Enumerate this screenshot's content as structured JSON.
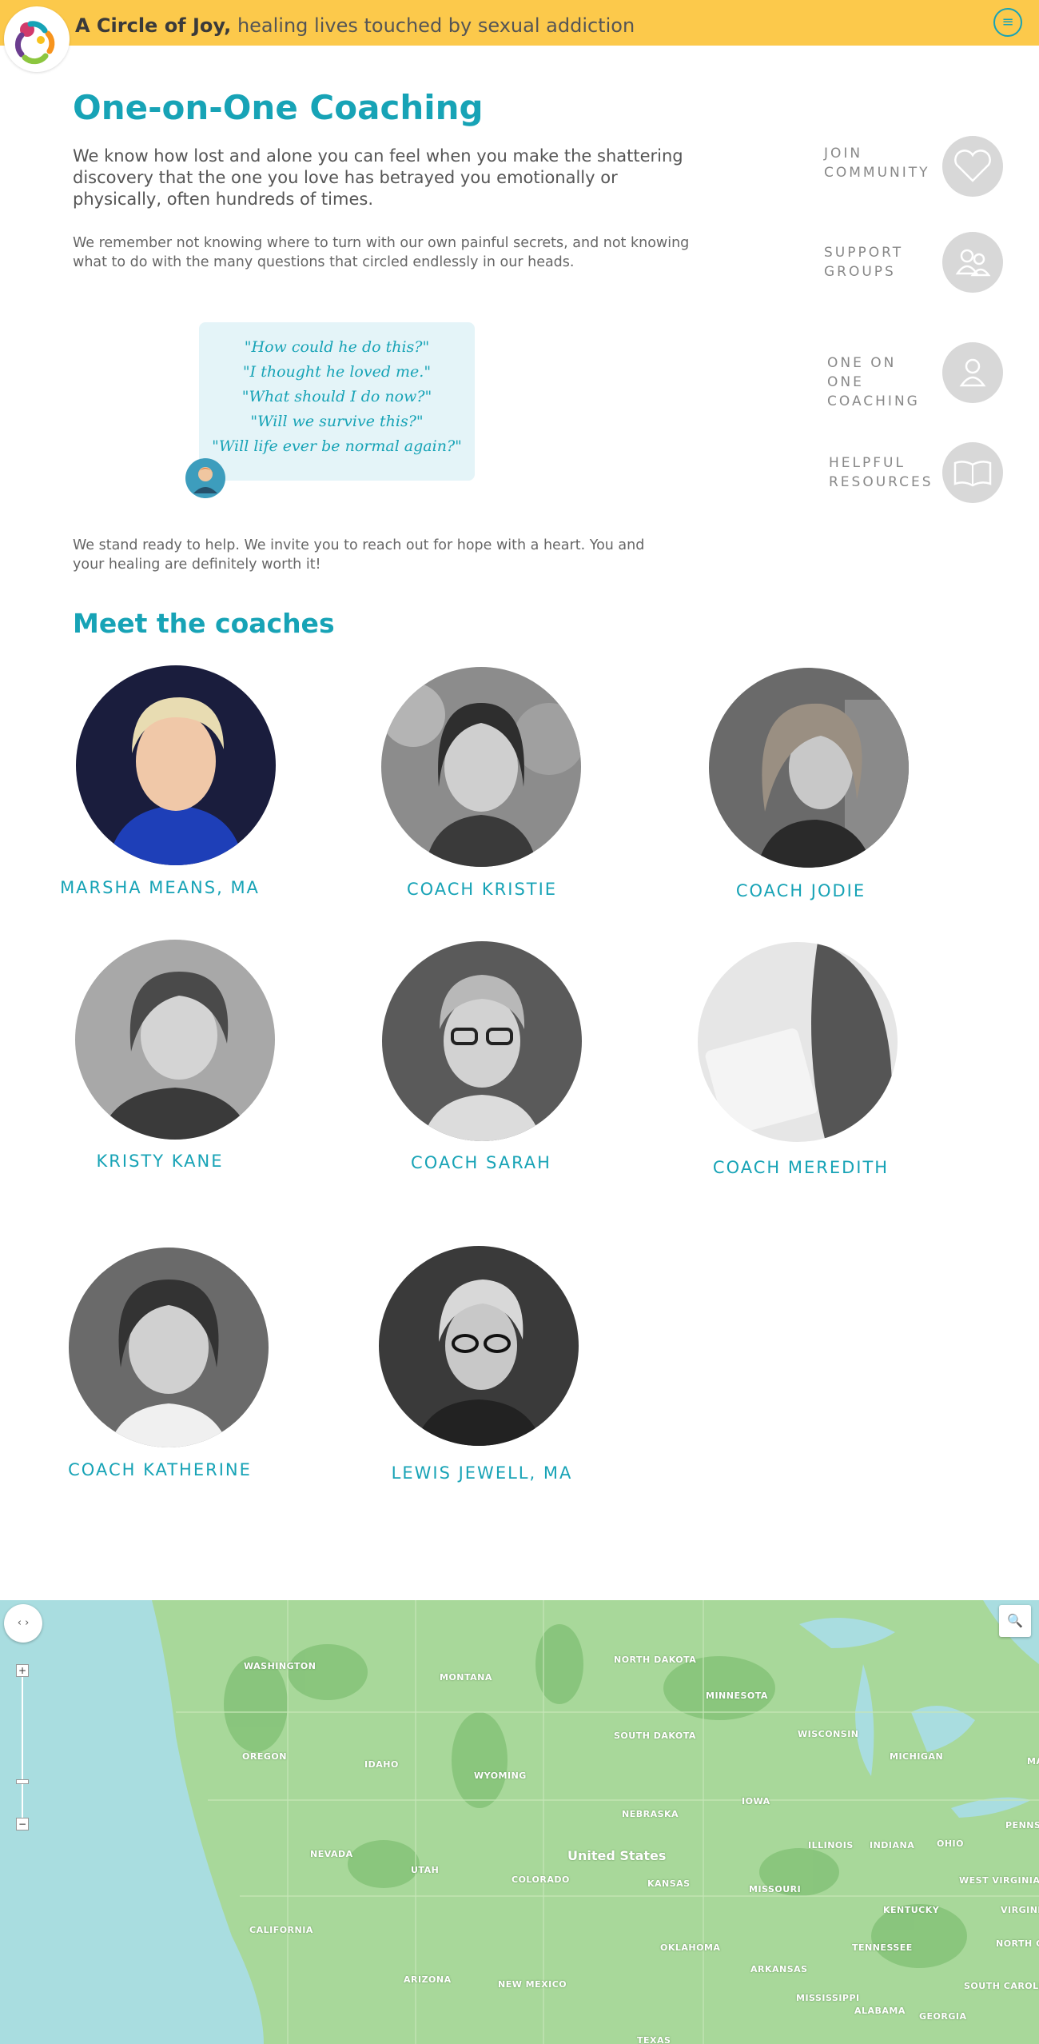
{
  "header": {
    "brand_name": "A Circle of Joy,",
    "tagline": "healing lives touched by sexual addiction",
    "menu_icon": "hamburger-icon"
  },
  "intro": {
    "title": "One-on-One Coaching",
    "lead": "We know how lost and alone you can feel when you make the shattering discovery that the one you love has betrayed you emotionally or physically, often hundreds of times.",
    "paragraph": "We remember not knowing where to turn with our own painful secrets, and not knowing what to do with the many questions that circled endlessly in our heads.",
    "quotes": [
      "\"How could he do this?\"",
      "\"I thought he loved me.\"",
      "\"What should I do now?\"",
      "\"Will we survive this?\"",
      "\"Will life ever be normal again?\""
    ],
    "closing": "We stand ready to help. We invite you to reach out for hope with a heart. You and your healing are definitely worth it!"
  },
  "side_nav": [
    {
      "label": "JOIN COMMUNITY",
      "icon": "heart-icon"
    },
    {
      "label": "SUPPORT GROUPS",
      "icon": "group-icon"
    },
    {
      "label": "ONE on ONE COACHING",
      "icon": "person-icon"
    },
    {
      "label": "HELPFUL RESOURCES",
      "icon": "book-icon"
    }
  ],
  "coaches": {
    "title": "Meet the coaches",
    "list": [
      {
        "name": "MARSHA MEANS, MA"
      },
      {
        "name": "COACH KRISTIE"
      },
      {
        "name": "COACH JODIE"
      },
      {
        "name": "KRISTY KANE"
      },
      {
        "name": "COACH SARAH"
      },
      {
        "name": "COACH MEREDITH"
      },
      {
        "name": "COACH KATHERINE"
      },
      {
        "name": "LEWIS JEWELL, MA"
      }
    ]
  },
  "map": {
    "country": "United States",
    "states": [
      "WASHINGTON",
      "MONTANA",
      "NORTH DAKOTA",
      "MINNESOTA",
      "OREGON",
      "IDAHO",
      "SOUTH DAKOTA",
      "WISCONSIN",
      "MICHIGAN",
      "WYOMING",
      "IOWA",
      "NEBRASKA",
      "NEVADA",
      "UTAH",
      "COLORADO",
      "ILLINOIS",
      "INDIANA",
      "OHIO",
      "PENNS",
      "KANSAS",
      "MISSOURI",
      "WEST VIRGINIA",
      "VIRGINI",
      "KENTUCKY",
      "CALIFORNIA",
      "OKLAHOMA",
      "TENNESSEE",
      "NORTH CAROLINA",
      "ARIZONA",
      "NEW MEXICO",
      "ARKANSAS",
      "SOUTH CAROLINA",
      "MISSISSIPPI",
      "ALABAMA",
      "GEORGIA",
      "TEXAS",
      "MA"
    ],
    "zoom_in": "+",
    "zoom_out": "−",
    "search_icon": "magnifier-icon"
  },
  "colors": {
    "header_bg": "#fcc94b",
    "accent": "#17a3b6",
    "quote_bg": "#e4f4f8",
    "map_land": "#a8d89a",
    "map_water": "#a9dde0"
  }
}
